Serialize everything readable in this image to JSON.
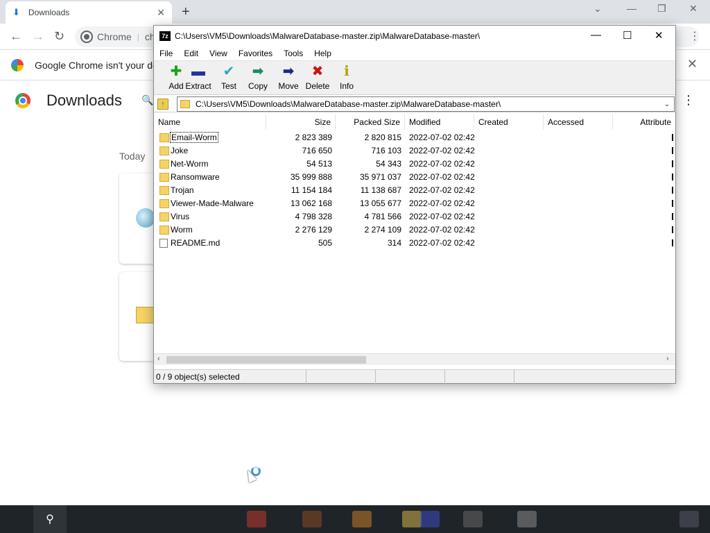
{
  "chrome": {
    "tab_title": "Downloads",
    "omnibox_site": "Chrome",
    "omnibox_url": "ch",
    "infobar_text": "Google Chrome isn't your def",
    "page_title": "Downloads",
    "section_today": "Today"
  },
  "sevenzip": {
    "app_icon_text": "7z",
    "title_path": "C:\\Users\\VM5\\Downloads\\MalwareDatabase-master.zip\\MalwareDatabase-master\\",
    "menu": [
      "File",
      "Edit",
      "View",
      "Favorites",
      "Tools",
      "Help"
    ],
    "toolbar": [
      {
        "label": "Add",
        "icon": "plus-icon",
        "glyph": "✚",
        "color": "#1aa31a"
      },
      {
        "label": "Extract",
        "icon": "minus-icon",
        "glyph": "▬",
        "color": "#2233aa"
      },
      {
        "label": "Test",
        "icon": "check-icon",
        "glyph": "✔",
        "color": "#2aa8b8"
      },
      {
        "label": "Copy",
        "icon": "copy-arrow-icon",
        "glyph": "➡",
        "color": "#1a8a6a"
      },
      {
        "label": "Move",
        "icon": "move-arrow-icon",
        "glyph": "➡",
        "color": "#1a2a8a"
      },
      {
        "label": "Delete",
        "icon": "delete-x-icon",
        "glyph": "✖",
        "color": "#cc1111"
      },
      {
        "label": "Info",
        "icon": "info-icon",
        "glyph": "ℹ",
        "color": "#b8a000"
      }
    ],
    "address": "C:\\Users\\VM5\\Downloads\\MalwareDatabase-master.zip\\MalwareDatabase-master\\",
    "columns": [
      "Name",
      "Size",
      "Packed Size",
      "Modified",
      "Created",
      "Accessed",
      "Attribute"
    ],
    "rows": [
      {
        "name": "Email-Worm",
        "size": "2 823 389",
        "packed": "2 820 815",
        "modified": "2022-07-02 02:42",
        "type": "folder"
      },
      {
        "name": "Joke",
        "size": "716 650",
        "packed": "716 103",
        "modified": "2022-07-02 02:42",
        "type": "folder"
      },
      {
        "name": "Net-Worm",
        "size": "54 513",
        "packed": "54 343",
        "modified": "2022-07-02 02:42",
        "type": "folder"
      },
      {
        "name": "Ransomware",
        "size": "35 999 888",
        "packed": "35 971 037",
        "modified": "2022-07-02 02:42",
        "type": "folder"
      },
      {
        "name": "Trojan",
        "size": "11 154 184",
        "packed": "11 138 687",
        "modified": "2022-07-02 02:42",
        "type": "folder"
      },
      {
        "name": "Viewer-Made-Malware",
        "size": "13 062 168",
        "packed": "13 055 677",
        "modified": "2022-07-02 02:42",
        "type": "folder"
      },
      {
        "name": "Virus",
        "size": "4 798 328",
        "packed": "4 781 566",
        "modified": "2022-07-02 02:42",
        "type": "folder"
      },
      {
        "name": "Worm",
        "size": "2 276 129",
        "packed": "2 274 109",
        "modified": "2022-07-02 02:42",
        "type": "folder"
      },
      {
        "name": "README.md",
        "size": "505",
        "packed": "314",
        "modified": "2022-07-02 02:42",
        "type": "file"
      }
    ],
    "status": "0 / 9 object(s) selected"
  }
}
